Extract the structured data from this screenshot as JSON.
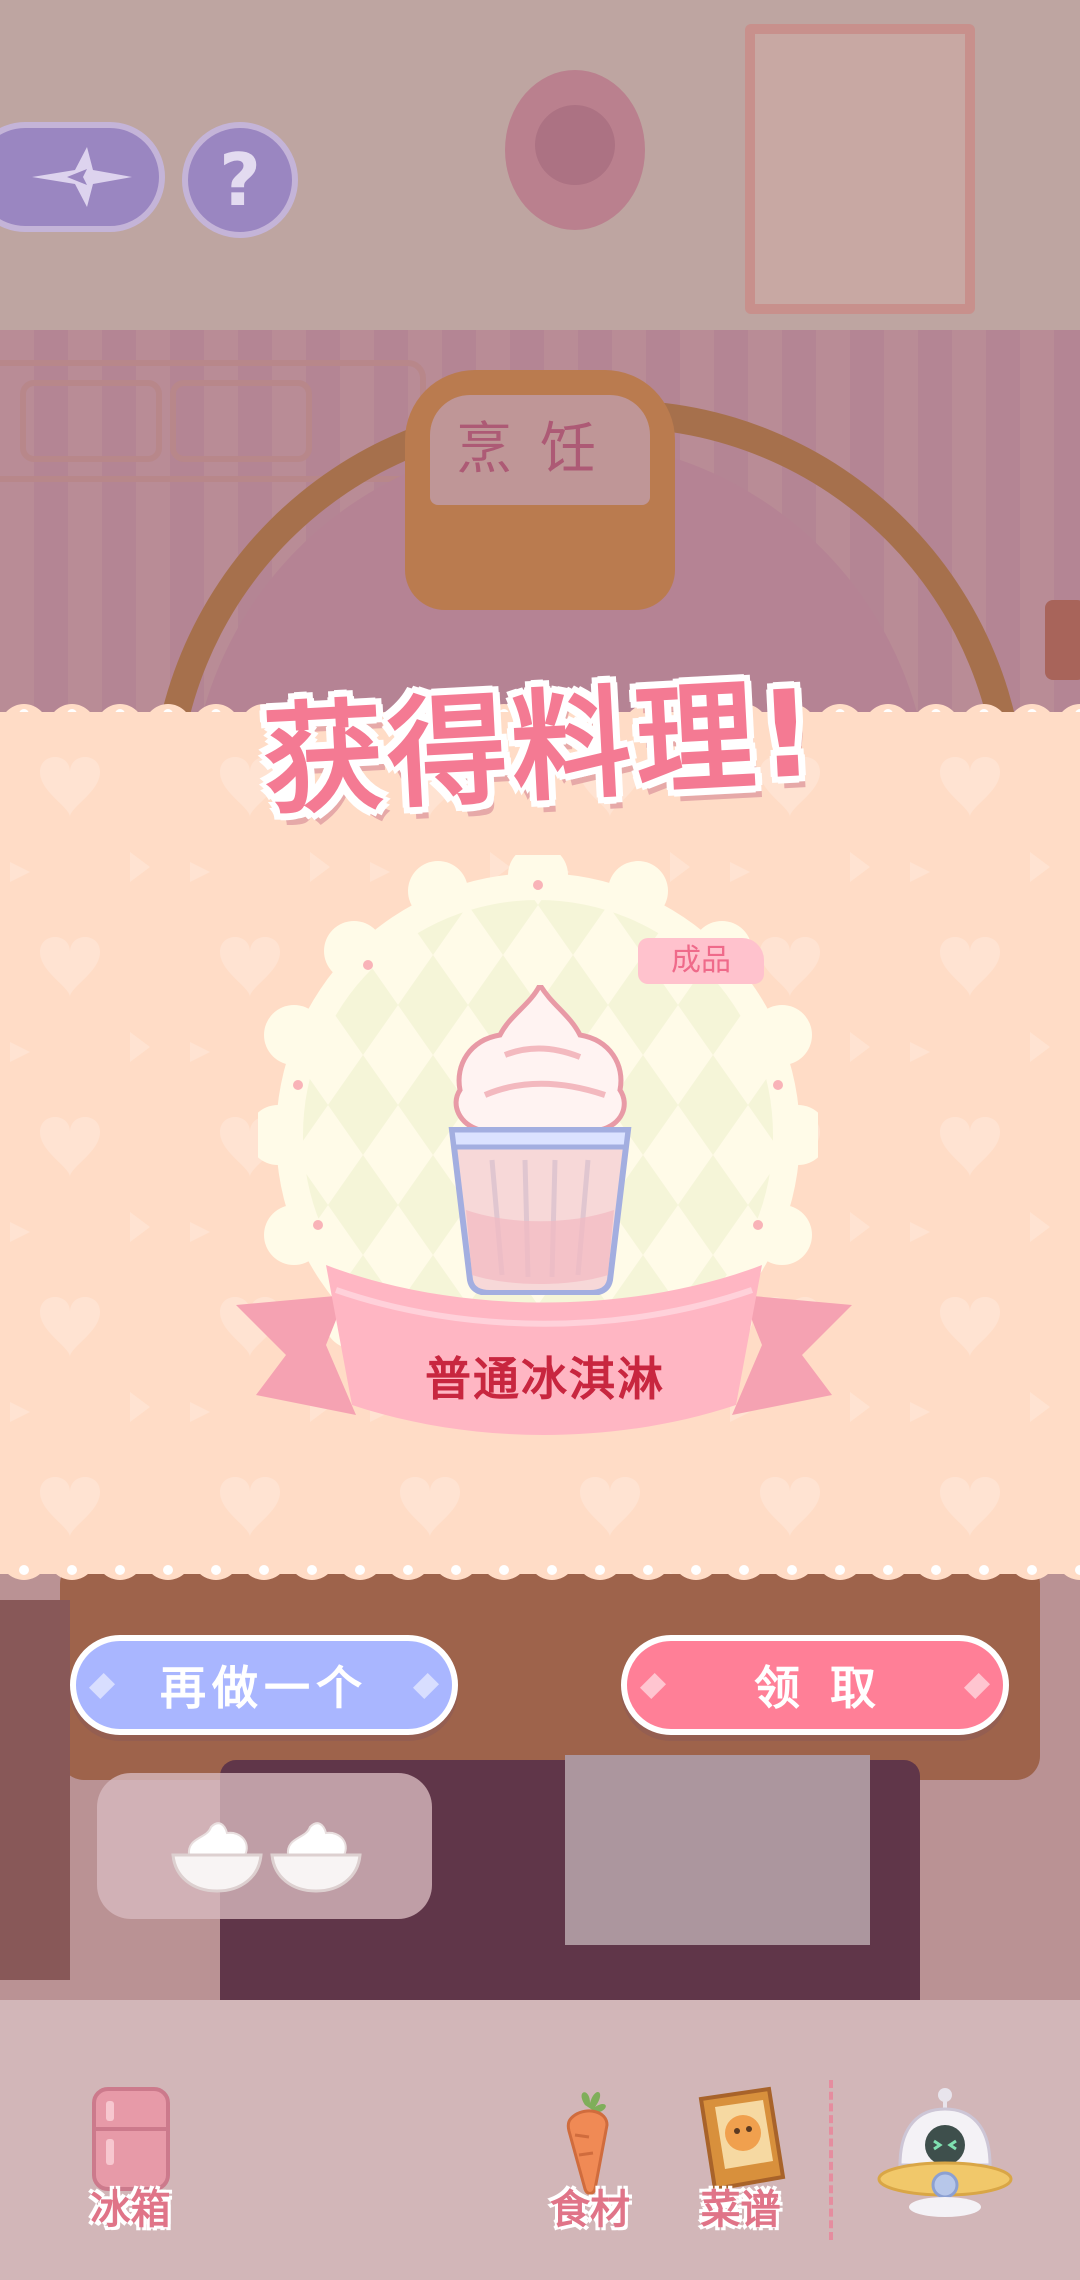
{
  "header": {
    "back_icon": "compass-arrow-icon",
    "help_label": "?"
  },
  "background": {
    "sign_text": "烹饪"
  },
  "reward": {
    "title": "获得料理!",
    "tag": "成品",
    "dish_name": "普通冰淇淋",
    "dish_icon": "ice-cream-cup-icon"
  },
  "actions": {
    "again_label": "再做一个",
    "claim_label": "领取"
  },
  "ingredients_tray": {
    "items": [
      "whipped-cream-bowl-icon",
      "whipped-cream-bowl-icon"
    ]
  },
  "nav": {
    "items": [
      {
        "label": "冰箱",
        "icon": "fridge-icon"
      },
      {
        "label": "食材",
        "icon": "carrot-icon"
      },
      {
        "label": "菜谱",
        "icon": "recipe-book-icon"
      },
      {
        "label": "",
        "icon": "robot-helper-icon"
      }
    ]
  },
  "colors": {
    "accent_pink": "#ff7f97",
    "accent_blue": "#a9b6ff",
    "banner_bg": "#ffdcc6",
    "dish_text": "#c8263f"
  }
}
